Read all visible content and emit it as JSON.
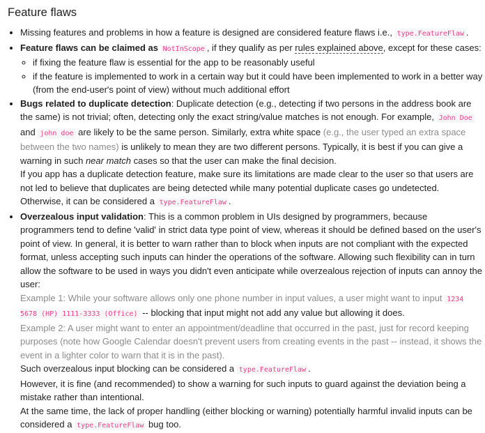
{
  "heading": "Feature flaws",
  "items": {
    "i1": {
      "text_a": "Missing features and problems in how a feature is designed are considered feature flaws i.e.,",
      "code_a": "type.FeatureFlaw",
      "text_b": "."
    },
    "i2": {
      "bold": "Feature flaws can be claimed as",
      "code": "NotInScope",
      "text_a": ", if they qualify as per",
      "link": "rules explained above",
      "text_b": ", except for these cases:",
      "sub1": "if fixing the feature flaw is essential for the app to be reasonably useful",
      "sub2": "if the feature is implemented to work in a certain way but it could have been implemented to work in a better way (from the end-user's point of view) without much additional effort"
    },
    "i3": {
      "bold": "Bugs related to duplicate detection",
      "text_a": ": Duplicate detection (e.g., detecting if two persons in the address book are the same) is not trivial; often, detecting only the exact string/value matches is not enough. For example,",
      "code_a": "John Doe",
      "text_b": "and",
      "code_b": "john doe",
      "text_c": "are likely to be the same person. Similarly, extra white space",
      "muted": "(e.g., the user typed an extra space between the two names)",
      "text_d": "is unlikely to mean they are two different persons. Typically, it is best if you can give a warning in such",
      "italic": "near match",
      "text_e": "cases so that the user can make the final decision.",
      "para2": "If you app has a duplicate detection feature, make sure its limitations are made clear to the user so that users are not led to believe that duplicates are being detected while many potential duplicate cases go undetected. Otherwise, it can be considered a",
      "code_c": "type.FeatureFlaw",
      "para2_end": "."
    },
    "i4": {
      "bold": "Overzealous input validation",
      "text_a": ": This is a common problem in UIs designed by programmers, because programmers tend to define 'valid' in strict data type point of view, whereas it should be defined based on the user's point of view. In general, it is better to warn rather than to block when inputs are not compliant with the expected format, unless accepting such inputs can hinder the operations of the software. Allowing such flexibility can in turn allow the software to be used in ways you didn't even anticipate while overzealous rejection of inputs can annoy the user:",
      "ex1_a": "Example 1: While your software allows only one phone number in input values, a user might want to input",
      "ex1_code": "1234 5678 (HP) 1111-3333 (Office)",
      "ex1_b": "-- blocking that input might not add any value but allowing it does.",
      "ex2": "Example 2: A user might want to enter an appointment/deadline that occurred in the past, just for record keeping purposes (note how Google Calendar doesn't prevent users from creating events in the past -- instead, it shows the event in a lighter color to warn that it is in the past).",
      "p3_a": "Such overzealous input blocking can be considered a",
      "p3_code": "type.FeatureFlaw",
      "p3_b": ".",
      "p4": "However, it is fine (and recommended) to show a warning for such inputs to guard against the deviation being a mistake rather than intentional.",
      "p5_a": "At the same time, the lack of proper handling (either blocking or warning) potentially harmful invalid inputs can be considered a",
      "p5_code": "type.FeatureFlaw",
      "p5_b": "bug too."
    }
  }
}
